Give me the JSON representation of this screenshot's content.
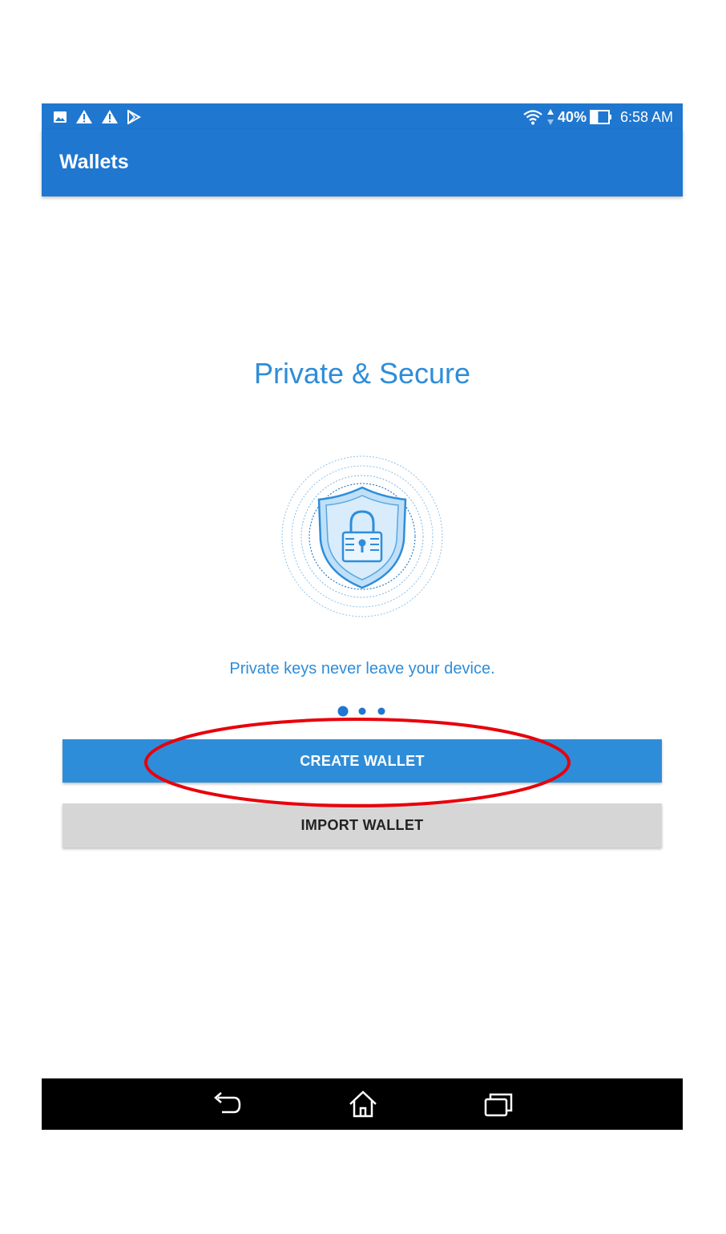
{
  "status_bar": {
    "icons_left": [
      "image-icon",
      "warning-icon",
      "warning-icon",
      "play-store-icon"
    ],
    "wifi_icon": "wifi-icon",
    "battery_percent": "40%",
    "battery_level": 0.4,
    "time": "6:58 AM"
  },
  "app_bar": {
    "title": "Wallets"
  },
  "onboarding": {
    "headline": "Private & Secure",
    "illustration_icon": "shield-lock-icon",
    "subtitle": "Private keys never leave your device.",
    "page_count": 3,
    "active_page": 0
  },
  "actions": {
    "create_label": "CREATE WALLET",
    "import_label": "IMPORT WALLET"
  },
  "annotation": {
    "color": "#e8000b",
    "target": "create-wallet-button"
  },
  "nav_bar": {
    "icons": [
      "back-icon",
      "home-icon",
      "recents-icon"
    ]
  },
  "colors": {
    "primary": "#1f77d0",
    "accent": "#2e8dd9",
    "secondary_button": "#d6d6d6"
  }
}
